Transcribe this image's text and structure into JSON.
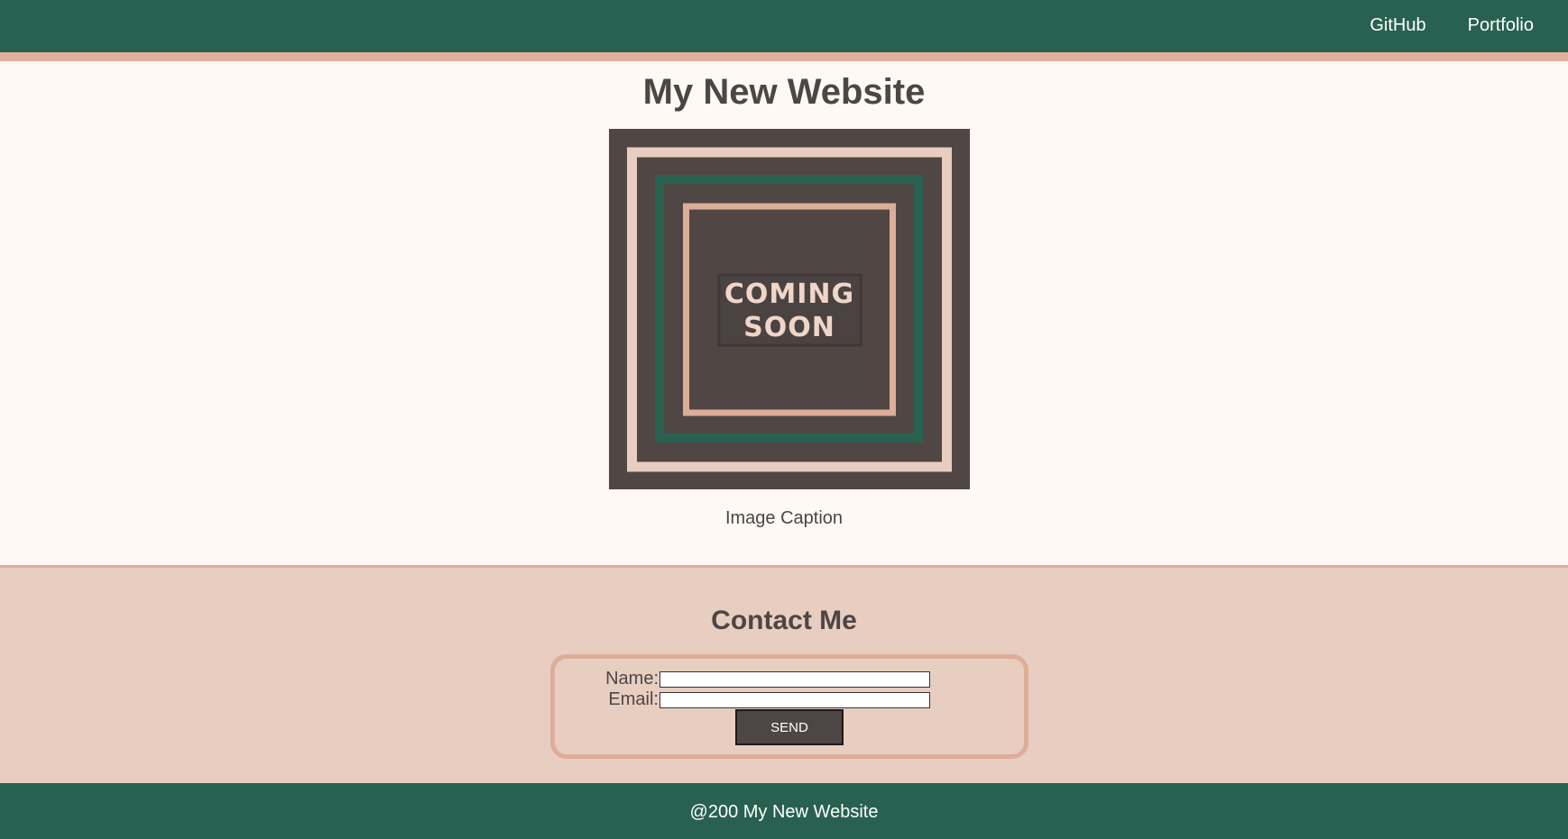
{
  "nav": {
    "links": [
      "GitHub",
      "Portfolio"
    ]
  },
  "main": {
    "title": "My New Website",
    "image": {
      "text_line1": "COMING",
      "text_line2": "SOON"
    },
    "caption": "Image Caption"
  },
  "contact": {
    "title": "Contact Me",
    "name_label": "Name:",
    "email_label": "Email:",
    "name_value": "",
    "email_value": "",
    "send_label": "SEND"
  },
  "footer": {
    "text": "@200 My New Website"
  },
  "colors": {
    "header_green": "#286150",
    "accent_peach": "#e1b29b",
    "text_dark": "#4e4644",
    "background": "#fff8f5",
    "contact_bg": "#e8cdc1"
  }
}
